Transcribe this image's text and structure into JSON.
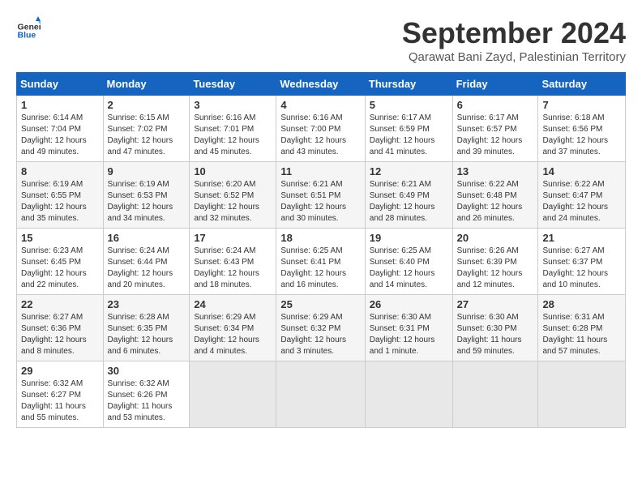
{
  "logo": {
    "general": "General",
    "blue": "Blue"
  },
  "title": "September 2024",
  "subtitle": "Qarawat Bani Zayd, Palestinian Territory",
  "days_header": [
    "Sunday",
    "Monday",
    "Tuesday",
    "Wednesday",
    "Thursday",
    "Friday",
    "Saturday"
  ],
  "weeks": [
    [
      {
        "day": "1",
        "info": "Sunrise: 6:14 AM\nSunset: 7:04 PM\nDaylight: 12 hours and 49 minutes."
      },
      {
        "day": "2",
        "info": "Sunrise: 6:15 AM\nSunset: 7:02 PM\nDaylight: 12 hours and 47 minutes."
      },
      {
        "day": "3",
        "info": "Sunrise: 6:16 AM\nSunset: 7:01 PM\nDaylight: 12 hours and 45 minutes."
      },
      {
        "day": "4",
        "info": "Sunrise: 6:16 AM\nSunset: 7:00 PM\nDaylight: 12 hours and 43 minutes."
      },
      {
        "day": "5",
        "info": "Sunrise: 6:17 AM\nSunset: 6:59 PM\nDaylight: 12 hours and 41 minutes."
      },
      {
        "day": "6",
        "info": "Sunrise: 6:17 AM\nSunset: 6:57 PM\nDaylight: 12 hours and 39 minutes."
      },
      {
        "day": "7",
        "info": "Sunrise: 6:18 AM\nSunset: 6:56 PM\nDaylight: 12 hours and 37 minutes."
      }
    ],
    [
      {
        "day": "8",
        "info": "Sunrise: 6:19 AM\nSunset: 6:55 PM\nDaylight: 12 hours and 35 minutes."
      },
      {
        "day": "9",
        "info": "Sunrise: 6:19 AM\nSunset: 6:53 PM\nDaylight: 12 hours and 34 minutes."
      },
      {
        "day": "10",
        "info": "Sunrise: 6:20 AM\nSunset: 6:52 PM\nDaylight: 12 hours and 32 minutes."
      },
      {
        "day": "11",
        "info": "Sunrise: 6:21 AM\nSunset: 6:51 PM\nDaylight: 12 hours and 30 minutes."
      },
      {
        "day": "12",
        "info": "Sunrise: 6:21 AM\nSunset: 6:49 PM\nDaylight: 12 hours and 28 minutes."
      },
      {
        "day": "13",
        "info": "Sunrise: 6:22 AM\nSunset: 6:48 PM\nDaylight: 12 hours and 26 minutes."
      },
      {
        "day": "14",
        "info": "Sunrise: 6:22 AM\nSunset: 6:47 PM\nDaylight: 12 hours and 24 minutes."
      }
    ],
    [
      {
        "day": "15",
        "info": "Sunrise: 6:23 AM\nSunset: 6:45 PM\nDaylight: 12 hours and 22 minutes."
      },
      {
        "day": "16",
        "info": "Sunrise: 6:24 AM\nSunset: 6:44 PM\nDaylight: 12 hours and 20 minutes."
      },
      {
        "day": "17",
        "info": "Sunrise: 6:24 AM\nSunset: 6:43 PM\nDaylight: 12 hours and 18 minutes."
      },
      {
        "day": "18",
        "info": "Sunrise: 6:25 AM\nSunset: 6:41 PM\nDaylight: 12 hours and 16 minutes."
      },
      {
        "day": "19",
        "info": "Sunrise: 6:25 AM\nSunset: 6:40 PM\nDaylight: 12 hours and 14 minutes."
      },
      {
        "day": "20",
        "info": "Sunrise: 6:26 AM\nSunset: 6:39 PM\nDaylight: 12 hours and 12 minutes."
      },
      {
        "day": "21",
        "info": "Sunrise: 6:27 AM\nSunset: 6:37 PM\nDaylight: 12 hours and 10 minutes."
      }
    ],
    [
      {
        "day": "22",
        "info": "Sunrise: 6:27 AM\nSunset: 6:36 PM\nDaylight: 12 hours and 8 minutes."
      },
      {
        "day": "23",
        "info": "Sunrise: 6:28 AM\nSunset: 6:35 PM\nDaylight: 12 hours and 6 minutes."
      },
      {
        "day": "24",
        "info": "Sunrise: 6:29 AM\nSunset: 6:34 PM\nDaylight: 12 hours and 4 minutes."
      },
      {
        "day": "25",
        "info": "Sunrise: 6:29 AM\nSunset: 6:32 PM\nDaylight: 12 hours and 3 minutes."
      },
      {
        "day": "26",
        "info": "Sunrise: 6:30 AM\nSunset: 6:31 PM\nDaylight: 12 hours and 1 minute."
      },
      {
        "day": "27",
        "info": "Sunrise: 6:30 AM\nSunset: 6:30 PM\nDaylight: 11 hours and 59 minutes."
      },
      {
        "day": "28",
        "info": "Sunrise: 6:31 AM\nSunset: 6:28 PM\nDaylight: 11 hours and 57 minutes."
      }
    ],
    [
      {
        "day": "29",
        "info": "Sunrise: 6:32 AM\nSunset: 6:27 PM\nDaylight: 11 hours and 55 minutes."
      },
      {
        "day": "30",
        "info": "Sunrise: 6:32 AM\nSunset: 6:26 PM\nDaylight: 11 hours and 53 minutes."
      },
      {
        "day": "",
        "info": ""
      },
      {
        "day": "",
        "info": ""
      },
      {
        "day": "",
        "info": ""
      },
      {
        "day": "",
        "info": ""
      },
      {
        "day": "",
        "info": ""
      }
    ]
  ]
}
